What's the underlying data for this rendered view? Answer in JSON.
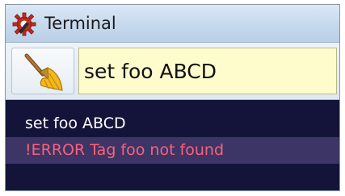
{
  "window": {
    "title": "Terminal",
    "app_icon": "gear-wrench-icon"
  },
  "toolbar": {
    "clear_button_icon": "broom-icon",
    "command_input_value": "set foo ABCD"
  },
  "output": {
    "lines": [
      {
        "text": "set foo ABCD",
        "type": "normal",
        "color": "#ffffff"
      },
      {
        "text": "!ERROR Tag foo not found",
        "type": "error",
        "color": "#ff5f7a"
      }
    ]
  },
  "colors": {
    "output_background": "#14143a",
    "error_row_background": "#3c3566",
    "input_background": "#fefccd"
  }
}
